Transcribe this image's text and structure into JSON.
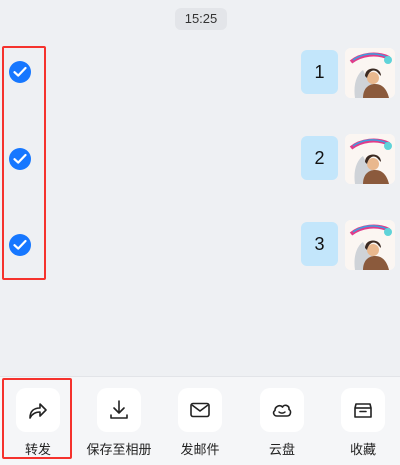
{
  "timestamp": "15:25",
  "colors": {
    "accent": "#1677ff",
    "highlight": "#f5322d",
    "bubble": "#c3e6fb"
  },
  "messages": [
    {
      "text": "1",
      "selected": true,
      "avatar_icon": "sticker-avatar-icon"
    },
    {
      "text": "2",
      "selected": true,
      "avatar_icon": "sticker-avatar-icon"
    },
    {
      "text": "3",
      "selected": true,
      "avatar_icon": "sticker-avatar-icon"
    }
  ],
  "toolbar": {
    "items": [
      {
        "label": "转发",
        "icon": "share-arrow-icon"
      },
      {
        "label": "保存至相册",
        "icon": "download-icon"
      },
      {
        "label": "发邮件",
        "icon": "mail-icon"
      },
      {
        "label": "云盘",
        "icon": "cloud-icon"
      },
      {
        "label": "收藏",
        "icon": "favorites-box-icon"
      }
    ]
  }
}
